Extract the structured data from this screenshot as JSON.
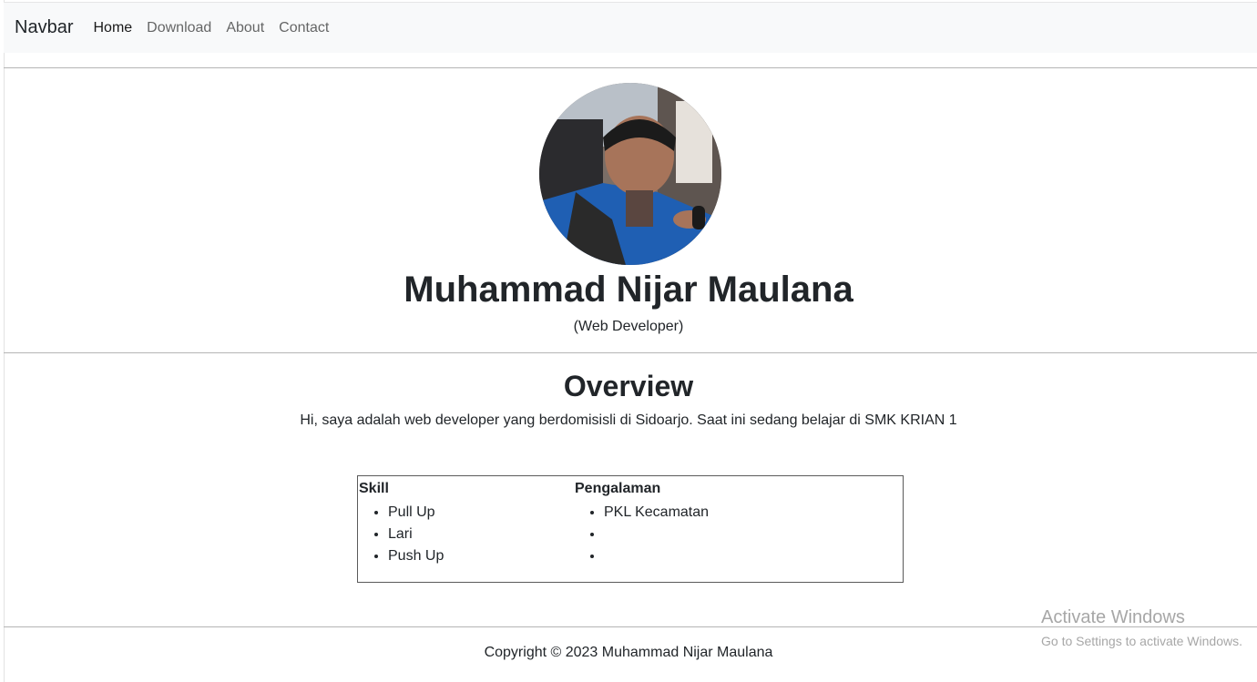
{
  "navbar": {
    "brand": "Navbar",
    "links": [
      {
        "label": "Home"
      },
      {
        "label": "Download"
      },
      {
        "label": "About"
      },
      {
        "label": "Contact"
      }
    ]
  },
  "profile": {
    "name": "Muhammad Nijar Maulana",
    "role": "(Web Developer)"
  },
  "overview": {
    "title": "Overview",
    "text": "Hi, saya adalah web developer yang berdomisisli di Sidoarjo. Saat ini sedang belajar di SMK KRIAN 1"
  },
  "table": {
    "skill_header": "Skill",
    "skills": [
      "Pull Up",
      "Lari",
      "Push Up"
    ],
    "experience_header": "Pengalaman",
    "experiences": [
      "PKL Kecamatan",
      "",
      ""
    ]
  },
  "footer": {
    "copyright": "Copyright © 2023 Muhammad Nijar Maulana"
  },
  "watermark": {
    "title": "Activate Windows",
    "subtitle": "Go to Settings to activate Windows."
  },
  "colors": {
    "navbar_bg": "#f8f9fa",
    "text": "#212529",
    "nav_inactive": "rgba(0,0,0,0.6)"
  }
}
